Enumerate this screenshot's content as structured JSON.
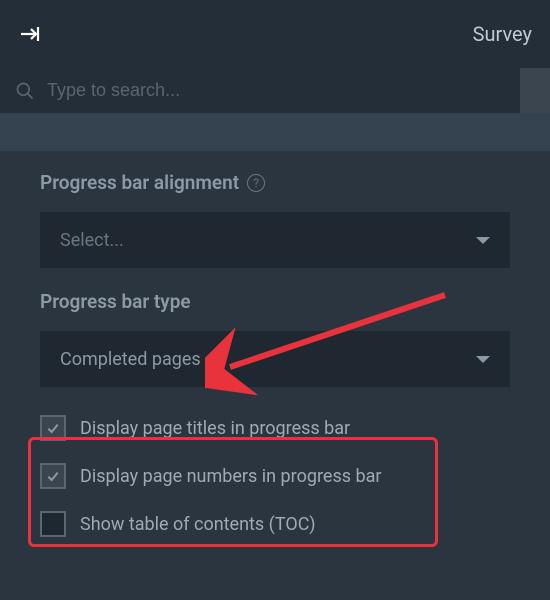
{
  "topbar": {
    "title": "Survey"
  },
  "search": {
    "placeholder": "Type to search..."
  },
  "fields": {
    "alignment": {
      "label": "Progress bar alignment",
      "value": "Select..."
    },
    "type": {
      "label": "Progress bar type",
      "value": "Completed pages"
    }
  },
  "checkboxes": {
    "titles": {
      "label": "Display page titles in progress bar",
      "checked": true
    },
    "numbers": {
      "label": "Display page numbers in progress bar",
      "checked": true
    },
    "toc": {
      "label": "Show table of contents (TOC)",
      "checked": false
    }
  }
}
